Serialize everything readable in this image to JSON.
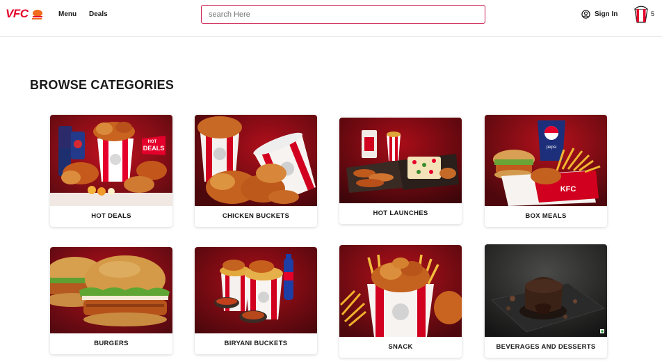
{
  "brand": {
    "logo_text": "VFC",
    "accent_color": "#e4002b"
  },
  "nav": {
    "menu_label": "Menu",
    "deals_label": "Deals"
  },
  "search": {
    "placeholder": "search Here",
    "border_color": "#c9184a"
  },
  "account": {
    "signin_label": "Sign In",
    "icon": "user-circle-icon"
  },
  "cart": {
    "icon": "bucket-cart-icon",
    "count": "5"
  },
  "browse": {
    "title": "BROWSE CATEGORIES",
    "categories": [
      {
        "label": "HOT DEALS",
        "badge_line1": "HOT",
        "badge_line2": "DEALS"
      },
      {
        "label": "CHICKEN BUCKETS"
      },
      {
        "label": "HOT LAUNCHES"
      },
      {
        "label": "BOX MEALS",
        "cup_text": "pepsi",
        "box_text": "KFC"
      },
      {
        "label": "BURGERS"
      },
      {
        "label": "BIRYANI BUCKETS"
      },
      {
        "label": "SNACK"
      },
      {
        "label": "BEVERAGES AND DESSERTS"
      }
    ]
  }
}
